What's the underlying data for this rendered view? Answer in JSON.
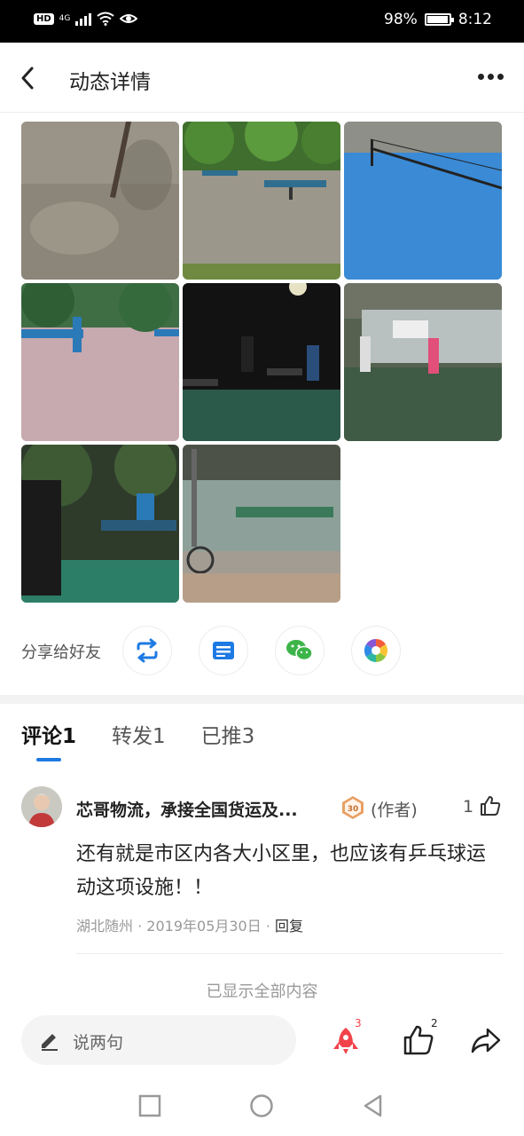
{
  "status_bar": {
    "hd": "HD",
    "network": "4G",
    "battery": "98%",
    "battery_level": 0.98,
    "time": "8:12"
  },
  "header": {
    "title": "动态详情",
    "back_icon": "chevron-left-icon",
    "more_icon": "more-horizontal-icon"
  },
  "gallery": {
    "photos": [
      "photo-ground-pole",
      "photo-outdoor-tables",
      "photo-blue-table-net",
      "photo-plaza-players",
      "photo-night-players",
      "photo-covered-court",
      "photo-evening-player",
      "photo-shelter-bikes"
    ]
  },
  "share": {
    "label": "分享给好友",
    "targets": [
      "repost-icon",
      "card-icon",
      "wechat-icon",
      "moments-icon"
    ]
  },
  "tabs": [
    {
      "label": "评论1",
      "active": true
    },
    {
      "label": "转发1",
      "active": false
    },
    {
      "label": "已推3",
      "active": false
    }
  ],
  "comment": {
    "user_name": "芯哥物流，承接全国货运及...",
    "level_badge": "30",
    "author_tag": "(作者)",
    "like_count": "1",
    "text": "还有就是市区内各大小区里，也应该有乒乓球运动这项设施！！",
    "location": "湖北随州",
    "separator": "·",
    "date": "2019年05月30日",
    "reply": "回复"
  },
  "footer_note": "已显示全部内容",
  "bottom_bar": {
    "input_placeholder": "说两句",
    "push_count": "3",
    "like_count": "2",
    "colors": {
      "push": "#f2434a",
      "accent": "#1e7ae3"
    }
  },
  "nav": [
    "square-icon",
    "circle-icon",
    "triangle-back-icon"
  ]
}
